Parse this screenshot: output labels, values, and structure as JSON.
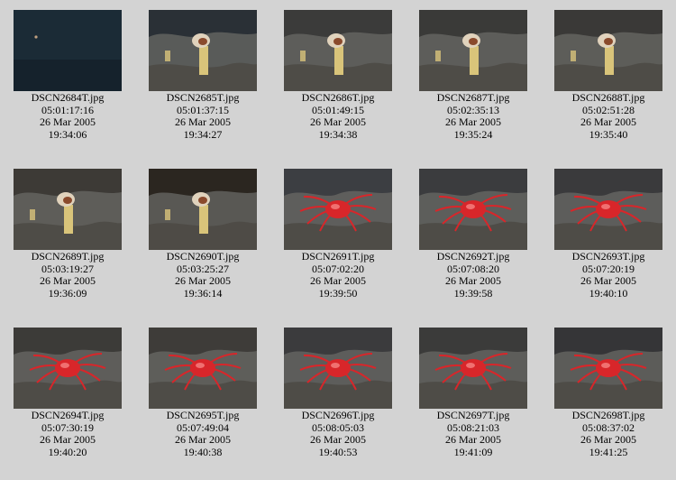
{
  "thumbnails": [
    {
      "filename": "DSCN2684T.jpg",
      "elapsed": "05:01:17:16",
      "date": "26 Mar 2005",
      "time": "19:34:06",
      "subject": "dark",
      "water": "#1b2b36"
    },
    {
      "filename": "DSCN2685T.jpg",
      "elapsed": "05:01:37:15",
      "date": "26 Mar 2005",
      "time": "19:34:27",
      "subject": "tubeworm",
      "water": "#2a3036"
    },
    {
      "filename": "DSCN2686T.jpg",
      "elapsed": "05:01:49:15",
      "date": "26 Mar 2005",
      "time": "19:34:38",
      "subject": "tubeworm",
      "water": "#3b3b3a"
    },
    {
      "filename": "DSCN2687T.jpg",
      "elapsed": "05:02:35:13",
      "date": "26 Mar 2005",
      "time": "19:35:24",
      "subject": "tubeworm",
      "water": "#3a3a38"
    },
    {
      "filename": "DSCN2688T.jpg",
      "elapsed": "05:02:51:28",
      "date": "26 Mar 2005",
      "time": "19:35:40",
      "subject": "tubeworm",
      "water": "#3a3937"
    },
    {
      "filename": "DSCN2689T.jpg",
      "elapsed": "05:03:19:27",
      "date": "26 Mar 2005",
      "time": "19:36:09",
      "subject": "tubeworm",
      "water": "#3d3a36"
    },
    {
      "filename": "DSCN2690T.jpg",
      "elapsed": "05:03:25:27",
      "date": "26 Mar 2005",
      "time": "19:36:14",
      "subject": "tubeworm",
      "water": "#2b2620"
    },
    {
      "filename": "DSCN2691T.jpg",
      "elapsed": "05:07:02:20",
      "date": "26 Mar 2005",
      "time": "19:39:50",
      "subject": "crab",
      "water": "#3c3e42"
    },
    {
      "filename": "DSCN2692T.jpg",
      "elapsed": "05:07:08:20",
      "date": "26 Mar 2005",
      "time": "19:39:58",
      "subject": "crab",
      "water": "#3b3c3e"
    },
    {
      "filename": "DSCN2693T.jpg",
      "elapsed": "05:07:20:19",
      "date": "26 Mar 2005",
      "time": "19:40:10",
      "subject": "crab",
      "water": "#3a3a3c"
    },
    {
      "filename": "DSCN2694T.jpg",
      "elapsed": "05:07:30:19",
      "date": "26 Mar 2005",
      "time": "19:40:20",
      "subject": "crab",
      "water": "#3c3b38"
    },
    {
      "filename": "DSCN2695T.jpg",
      "elapsed": "05:07:49:04",
      "date": "26 Mar 2005",
      "time": "19:40:38",
      "subject": "crab",
      "water": "#3e3c39"
    },
    {
      "filename": "DSCN2696T.jpg",
      "elapsed": "05:08:05:03",
      "date": "26 Mar 2005",
      "time": "19:40:53",
      "subject": "crab",
      "water": "#3b3b3d"
    },
    {
      "filename": "DSCN2697T.jpg",
      "elapsed": "05:08:21:03",
      "date": "26 Mar 2005",
      "time": "19:41:09",
      "subject": "crab",
      "water": "#3b3b3a"
    },
    {
      "filename": "DSCN2698T.jpg",
      "elapsed": "05:08:37:02",
      "date": "26 Mar 2005",
      "time": "19:41:25",
      "subject": "crab",
      "water": "#353537"
    }
  ],
  "colors": {
    "page_background": "#d3d3d3",
    "crab": "#d8262a",
    "tubeworm_stalk": "#d9c47a",
    "tubeworm_plume": "#e0d2bc",
    "rock": "#6a6a66"
  }
}
